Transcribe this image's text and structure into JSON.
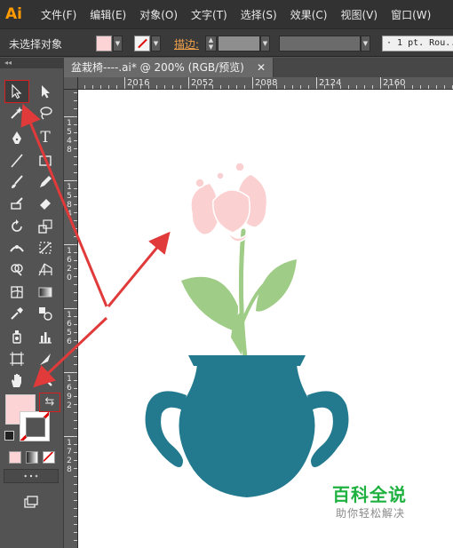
{
  "app": {
    "logo": "Ai",
    "menu": [
      "文件(F)",
      "编辑(E)",
      "对象(O)",
      "文字(T)",
      "选择(S)",
      "效果(C)",
      "视图(V)",
      "窗口(W)"
    ]
  },
  "control_bar": {
    "selection_status": "未选择对象",
    "stroke_label": "描边:",
    "brush_value": "· 1 pt. Rou..."
  },
  "document": {
    "tab_title": "盆栽椅----.ai* @ 200% (RGB/预览)",
    "close_symbol": "✕"
  },
  "rulers": {
    "horizontal_labels": [
      "2016",
      "2052",
      "2088",
      "2124",
      "2160"
    ],
    "vertical_labels": [
      "1548",
      "1584",
      "1620",
      "1656",
      "1692",
      "1728"
    ]
  },
  "toolbox": {
    "fill_color": "#fcd4d6",
    "stroke_color": "none",
    "selected_tool": "selection-tool"
  },
  "artwork": {
    "vase_color": "#237a8e",
    "leaf_color": "#9fcc86",
    "flower_color": "#fbd0d1"
  },
  "watermark": {
    "title": "百科全说",
    "subtitle": "助你轻松解决"
  },
  "annotation": {
    "arrow_color": "#e03a3a"
  }
}
